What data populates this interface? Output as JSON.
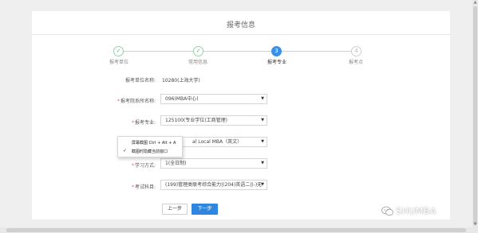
{
  "page": {
    "title": "报考信息"
  },
  "steps": [
    {
      "label": "报考单位",
      "icon": "✓",
      "state": "done"
    },
    {
      "label": "常用信息",
      "icon": "✓",
      "state": "done"
    },
    {
      "label": "报考专业",
      "icon": "3",
      "state": "active"
    },
    {
      "label": "报考点",
      "icon": "4",
      "state": "todo"
    }
  ],
  "form": {
    "unit_label": "报考单位名称:",
    "unit_value": "10280(上海大学)",
    "dept_label": "报考院系所名称:",
    "dept_value": "096(MBA中心)",
    "major_label": "报考专业:",
    "major_value": "125100(专业学位)工商管理)",
    "direction_value": "al Local MBA（英文）",
    "study_label": "学习方式:",
    "study_value": "1(全日制)",
    "subjects_label": "考试科目:",
    "subjects_value": "(199)管理类联考综合能力|(204)英语二|(-)无"
  },
  "context_menu": {
    "item1": "屏幕截图 Ctrl + Alt + A",
    "item2": "截图时隐藏当前窗口",
    "check": "✓"
  },
  "buttons": {
    "prev": "上一步",
    "next": "下一步"
  },
  "watermark": {
    "text": "SHUMBA"
  }
}
